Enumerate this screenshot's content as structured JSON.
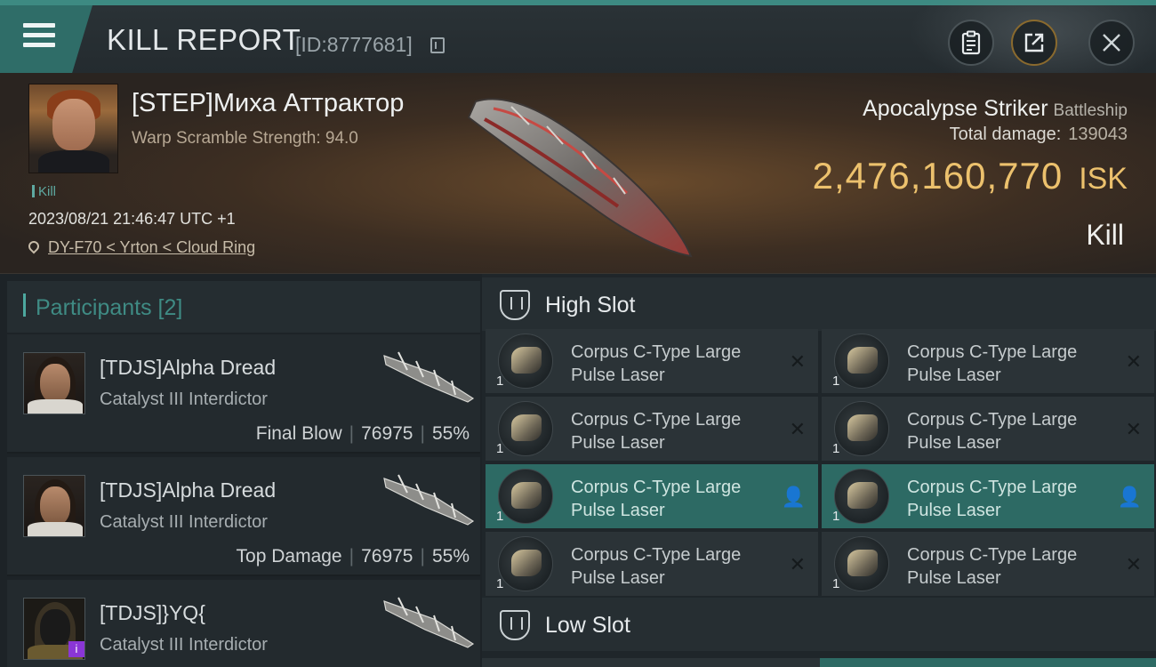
{
  "header": {
    "title": "KILL REPORT",
    "report_id": "[ID:8777681]"
  },
  "victim": {
    "name": "[STEP]Миха Аттрактор",
    "warp_scramble": "Warp Scramble Strength: 94.0",
    "tag": "Kill",
    "datetime": "2023/08/21 21:46:47 UTC +1",
    "location": "DY-F70 < Yrton < Cloud Ring",
    "ship_name": "Apocalypse Striker",
    "ship_class": "Battleship",
    "total_damage_label": "Total damage:",
    "total_damage": "139043",
    "isk_value": "2,476,160,770",
    "isk_unit": "ISK",
    "report_type": "Kill"
  },
  "participants": {
    "header": "Participants [2]",
    "items": [
      {
        "name": "[TDJS]Alpha Dread",
        "ship": "Catalyst III Interdictor",
        "role": "Final Blow",
        "damage": "76975",
        "percent": "55%"
      },
      {
        "name": "[TDJS]Alpha Dread",
        "ship": "Catalyst III Interdictor",
        "role": "Top Damage",
        "damage": "76975",
        "percent": "55%"
      },
      {
        "name": "[TDJS]}YQ{",
        "ship": "Catalyst III Interdictor",
        "badge": "i"
      }
    ]
  },
  "fittings": {
    "high_slot_title": "High Slot",
    "low_slot_title": "Low Slot",
    "modules": [
      {
        "line1": "Corpus C-Type Large",
        "line2": "Pulse Laser",
        "qty": "1",
        "status": "destroyed"
      },
      {
        "line1": "Corpus C-Type Large",
        "line2": "Pulse Laser",
        "qty": "1",
        "status": "destroyed"
      },
      {
        "line1": "Corpus C-Type Large",
        "line2": "Pulse Laser",
        "qty": "1",
        "status": "destroyed"
      },
      {
        "line1": "Corpus C-Type Large",
        "line2": "Pulse Laser",
        "qty": "1",
        "status": "destroyed"
      },
      {
        "line1": "Corpus C-Type Large",
        "line2": "Pulse Laser",
        "qty": "1",
        "status": "dropped"
      },
      {
        "line1": "Corpus C-Type Large",
        "line2": "Pulse Laser",
        "qty": "1",
        "status": "dropped"
      },
      {
        "line1": "Corpus C-Type Large",
        "line2": "Pulse Laser",
        "qty": "1",
        "status": "destroyed"
      },
      {
        "line1": "Corpus C-Type Large",
        "line2": "Pulse Laser",
        "qty": "1",
        "status": "destroyed"
      }
    ],
    "status_glyphs": {
      "destroyed": "✕",
      "dropped": "👤"
    }
  },
  "colors": {
    "accent": "#3d8a82",
    "isk": "#ecc16d",
    "selected_row": "#2d6a64"
  },
  "icons": [
    "menu-icon",
    "copy-icon",
    "clipboard-icon",
    "share-icon",
    "close-icon",
    "location-pin-icon",
    "high-slot-icon",
    "low-slot-icon",
    "laser-module-icon",
    "destroyed-x-icon",
    "dropped-person-icon"
  ]
}
